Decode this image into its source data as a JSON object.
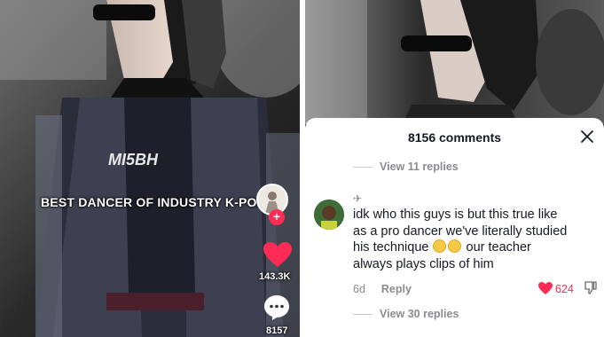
{
  "left_panel": {
    "caption": "BEST DANCER OF INDUSTRY K-POP",
    "likes": "143.3K",
    "comments": "8157"
  },
  "right_panel": {
    "sheet_title": "8156 comments",
    "comment": {
      "replies_top": "View 11 replies",
      "text_line1": "idk who this guys is but this true like",
      "text_line2": "as a pro dancer we've literally studied",
      "text_line3a": "his technique",
      "text_line3b": "our teacher",
      "text_line4": "always plays clips of him",
      "age": "6d",
      "reply_label": "Reply",
      "like_count": "624",
      "replies_bottom": "View 30 replies"
    }
  },
  "colors": {
    "accent": "#fe2c55",
    "muted": "#8a8b91",
    "text": "#161823"
  }
}
